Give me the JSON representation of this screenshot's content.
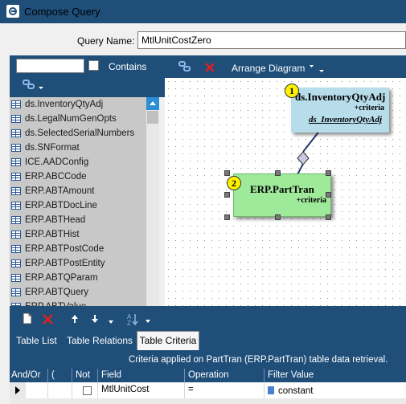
{
  "window": {
    "title": "Compose Query"
  },
  "query": {
    "name_label": "Query Name:",
    "name_value": "MtlUnitCostZero"
  },
  "left_panel": {
    "search_value": "",
    "contains_label": "Contains",
    "items": [
      {
        "label": "ds.InventoryQtyAdj"
      },
      {
        "label": "ds.LegalNumGenOpts"
      },
      {
        "label": "ds.SelectedSerialNumbers"
      },
      {
        "label": "ds.SNFormat"
      },
      {
        "label": "ICE.AADConfig"
      },
      {
        "label": "ERP.ABCCode"
      },
      {
        "label": "ERP.ABTAmount"
      },
      {
        "label": "ERP.ABTDocLine"
      },
      {
        "label": "ERP.ABTHead"
      },
      {
        "label": "ERP.ABTHist"
      },
      {
        "label": "ERP.ABTPostCode"
      },
      {
        "label": "ERP.ABTPostEntity"
      },
      {
        "label": "ERP.ABTQParam"
      },
      {
        "label": "ERP.ABTQuery"
      },
      {
        "label": "ERP.ABTValue"
      }
    ]
  },
  "diagram": {
    "arrange_label": "Arrange Diagram",
    "nodes": [
      {
        "number": "1",
        "title": "ds.InventoryQtyAdj",
        "criteria": "+criteria",
        "alias": "ds_InventoryQtyAdj"
      },
      {
        "number": "2",
        "title": "ERP.PartTran",
        "criteria": "+criteria"
      }
    ]
  },
  "tabs": [
    {
      "label": "Table List"
    },
    {
      "label": "Table Relations"
    },
    {
      "label": "Table Criteria"
    }
  ],
  "criteria": {
    "caption": "Criteria applied on PartTran (ERP.PartTran)  table data retrieval.",
    "columns": [
      "And/Or",
      "(",
      "Not",
      "Field",
      "Operation",
      "Filter Value"
    ],
    "row": {
      "field": "MtlUnitCost",
      "operation": "=",
      "filter_value": "constant"
    }
  },
  "colors": {
    "accent": "#1f4e79",
    "node1": "#b7dcea",
    "node2": "#9fea9a",
    "badge": "#fff200",
    "delete": "#e02020"
  },
  "icons": [
    "app-icon",
    "link-icon",
    "delete-icon",
    "new-icon",
    "move-up-icon",
    "move-down-icon",
    "sort-icon",
    "dropdown-arrow-icon"
  ]
}
